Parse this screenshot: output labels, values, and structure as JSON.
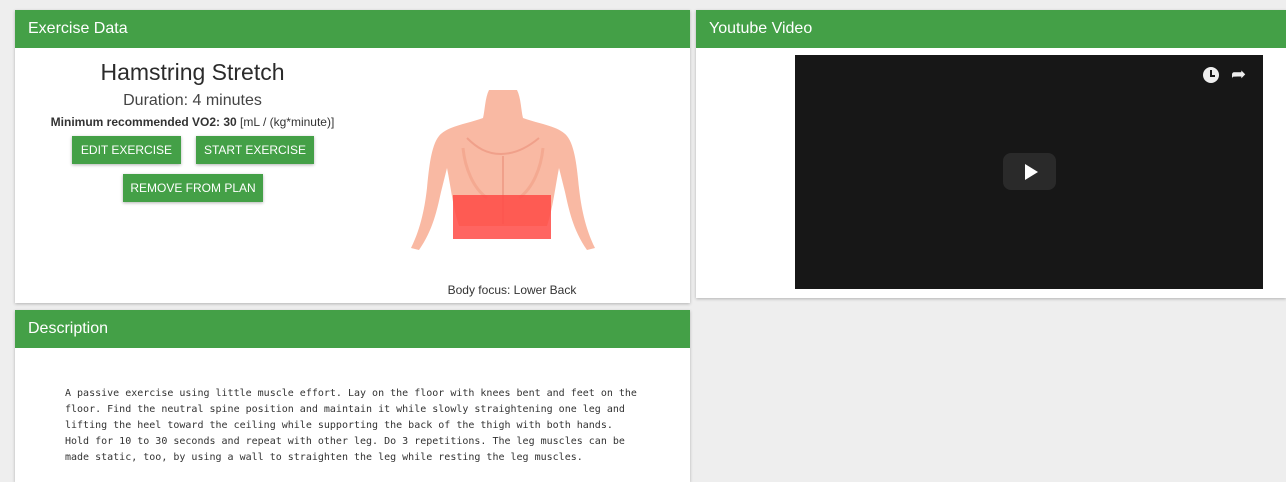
{
  "exercise_card": {
    "header": "Exercise Data",
    "title": "Hamstring Stretch",
    "duration": "Duration: 4 minutes",
    "vo2_label": "Minimum recommended VO2: 30",
    "vo2_unit": " [mL / (kg*minute)]",
    "edit_label": "EDIT EXERCISE",
    "start_label": "START EXERCISE",
    "remove_label": "REMOVE FROM PLAN",
    "body_focus": "Body focus: Lower Back"
  },
  "video_card": {
    "header": "Youtube Video"
  },
  "description_card": {
    "header": "Description",
    "text": "A passive exercise using little muscle effort. Lay on the floor with knees bent and feet on the\nfloor. Find the neutral spine position and maintain it while slowly straightening one leg and\nlifting the heel toward the ceiling while supporting the back of the thigh with both hands.\nHold for 10 to 30 seconds and repeat with other leg. Do 3 repetitions. The leg muscles can be\nmade static, too, by using a wall to straighten the leg while resting the leg muscles."
  },
  "colors": {
    "accent": "#44a047",
    "highlight": "#ff5a55",
    "skin": "#f9b9a3"
  },
  "icons": {
    "video_play": "play-icon",
    "video_watch_later": "clock-icon",
    "video_share": "share-icon"
  }
}
